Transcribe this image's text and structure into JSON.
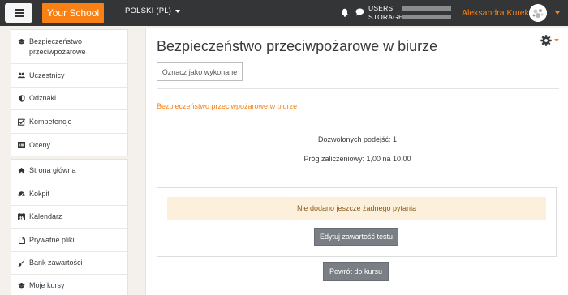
{
  "navbar": {
    "brand": "Your School",
    "language": "POLSKI (PL)",
    "usage_labels": [
      "USERS",
      "STORAGE"
    ],
    "user_name": "Aleksandra Kurek"
  },
  "sidebar": {
    "course_items": [
      {
        "label": "Bezpieczeństwo przeciwpożarowe",
        "icon": "graduation-cap-icon"
      },
      {
        "label": "Uczestnicy",
        "icon": "users-icon"
      },
      {
        "label": "Odznaki",
        "icon": "shield-icon"
      },
      {
        "label": "Kompetencje",
        "icon": "checkbox-icon"
      },
      {
        "label": "Oceny",
        "icon": "table-icon"
      }
    ],
    "site_items": [
      {
        "label": "Strona główna",
        "icon": "home-icon"
      },
      {
        "label": "Kokpit",
        "icon": "dashboard-icon"
      },
      {
        "label": "Kalendarz",
        "icon": "calendar-icon"
      },
      {
        "label": "Prywatne pliki",
        "icon": "file-icon"
      },
      {
        "label": "Bank zawartości",
        "icon": "paint-brush-icon"
      },
      {
        "label": "Moje kursy",
        "icon": "graduation-cap-icon"
      }
    ]
  },
  "main": {
    "title": "Bezpieczeństwo przeciwpożarowe w biurze",
    "mark_done_label": "Oznacz jako wykonane",
    "activity_link": "Bezpieczeństwo przeciwpożarowe w biurze",
    "attempts_allowed": "Dozwolonych podejść: 1",
    "passing_grade": "Próg zaliczeniowy: 1,00 na 10,00",
    "no_questions_notice": "Nie dodano jeszcze żadnego pytania",
    "edit_quiz_label": "Edytuj zawartość testu",
    "back_to_course_label": "Powrót do kursu"
  },
  "colors": {
    "accent": "#f98012",
    "navbar": "#333537",
    "notice_bg": "#fcefdc",
    "button_gray": "#7a7f85"
  }
}
